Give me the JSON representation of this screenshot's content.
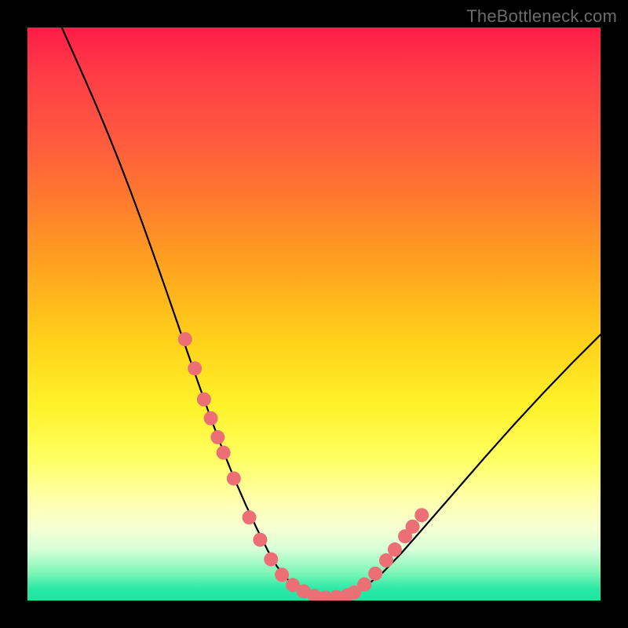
{
  "watermark": {
    "text": "TheBottleneck.com"
  },
  "chart_data": {
    "type": "line",
    "title": "",
    "xlabel": "",
    "ylabel": "",
    "xlim": [
      0,
      100
    ],
    "ylim": [
      0,
      100
    ],
    "grid": false,
    "legend": false,
    "series": [
      {
        "name": "bottleneck-curve",
        "color": "#000000",
        "x": [
          6,
          8,
          10,
          12,
          14,
          16,
          18,
          20,
          22,
          24,
          26,
          28,
          30,
          32,
          34,
          36,
          38,
          40,
          42,
          43.5,
          45,
          47,
          49,
          51,
          53,
          55,
          57,
          59,
          62,
          65,
          68,
          72,
          76,
          80,
          85,
          90,
          95,
          100
        ],
        "values": [
          100,
          95.5,
          91,
          86.4,
          81.6,
          76.6,
          71.4,
          66,
          60.4,
          54.7,
          48.9,
          43.1,
          37.4,
          31.8,
          26.5,
          21.5,
          16.9,
          12.6,
          8.6,
          6.0,
          4.0,
          2.4,
          1.3,
          0.7,
          0.5,
          0.7,
          1.3,
          2.5,
          4.9,
          8.0,
          11.4,
          16.0,
          20.6,
          25.2,
          30.8,
          36.2,
          41.4,
          46.4
        ]
      }
    ],
    "highlight_points": {
      "name": "highlighted-range",
      "color": "#ed6f76",
      "radius": 9,
      "x": [
        27.5,
        29.2,
        30.8,
        32.0,
        33.2,
        34.2,
        36.0,
        38.7,
        40.6,
        42.5,
        44.4,
        46.3,
        48.2,
        50.1,
        52.0,
        53.9,
        55.8,
        57.0,
        58.8,
        60.7,
        62.6,
        64.1,
        65.9,
        67.2,
        68.8
      ],
      "values": [
        45.6,
        40.5,
        35.1,
        31.8,
        28.5,
        25.8,
        21.3,
        14.5,
        10.6,
        7.2,
        4.5,
        2.7,
        1.6,
        0.8,
        0.5,
        0.6,
        0.9,
        1.4,
        2.8,
        4.7,
        7.0,
        8.9,
        11.2,
        12.9,
        14.9
      ]
    },
    "background_gradient": {
      "orientation": "vertical",
      "stops": [
        {
          "pos": 0.0,
          "color": "#ff1c47"
        },
        {
          "pos": 0.3,
          "color": "#ff7a2e"
        },
        {
          "pos": 0.55,
          "color": "#ffd21a"
        },
        {
          "pos": 0.75,
          "color": "#ffff60"
        },
        {
          "pos": 0.9,
          "color": "#d8ffd8"
        },
        {
          "pos": 1.0,
          "color": "#1ee6a3"
        }
      ]
    }
  }
}
